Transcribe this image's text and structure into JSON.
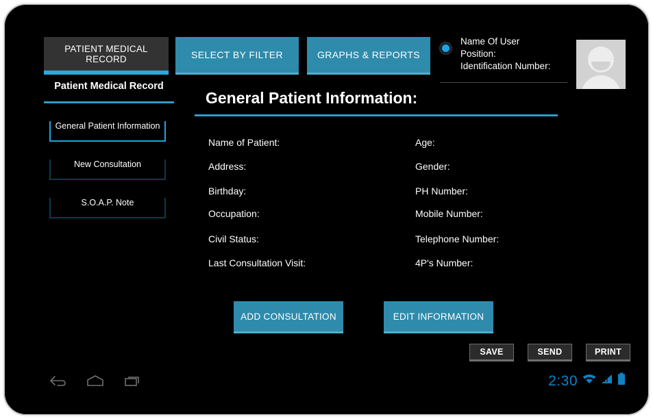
{
  "device": {
    "frame_color": "#e9e9e9",
    "screen_bg": "#000000"
  },
  "theme": {
    "accent_blue": "#28a8e0",
    "button_blue": "#2e8bab",
    "button_blue_edge": "#4fb0cc",
    "tab_gray": "#333333",
    "status_blue": "#1181c4"
  },
  "topbar": {
    "record_tab": "PATIENT MEDICAL RECORD",
    "tabs": [
      {
        "label": "SELECT BY FILTER",
        "name": "tab-select-by-filter"
      },
      {
        "label": "GRAPHS & REPORTS",
        "name": "tab-graphs-reports"
      }
    ],
    "user": {
      "name": "Name Of User",
      "position": "Position:",
      "identification": "Identification Number:"
    }
  },
  "sidebar": {
    "title": "Patient Medical Record",
    "items": [
      {
        "label": "General Patient Information",
        "active": true
      },
      {
        "label": "New Consultation",
        "active": false
      },
      {
        "label": "S.O.A.P. Note",
        "active": false
      }
    ]
  },
  "main": {
    "title": "General Patient Information:",
    "fields_left": [
      "Name of Patient:",
      "Address:",
      "Birthday:",
      "Occupation:",
      "Civil Status:",
      "Last Consultation Visit:"
    ],
    "fields_right": [
      "Age:",
      "Gender:",
      "PH Number:",
      "Mobile Number:",
      "Telephone Number:",
      "4P's Number:"
    ],
    "actions": [
      {
        "label": "ADD CONSULTATION",
        "name": "add-consultation-button"
      },
      {
        "label": "EDIT INFORMATION",
        "name": "edit-information-button"
      }
    ],
    "tools": [
      {
        "label": "SAVE",
        "name": "save-button"
      },
      {
        "label": "SEND",
        "name": "send-button"
      },
      {
        "label": "PRINT",
        "name": "print-button"
      }
    ]
  },
  "systembar": {
    "back_icon": "back-arrow-icon",
    "home_icon": "home-icon",
    "recent_icon": "recent-apps-icon",
    "clock": "2:30",
    "wifi_icon": "wifi-icon",
    "signal_icon": "cellular-signal-icon",
    "battery_icon": "battery-icon"
  }
}
